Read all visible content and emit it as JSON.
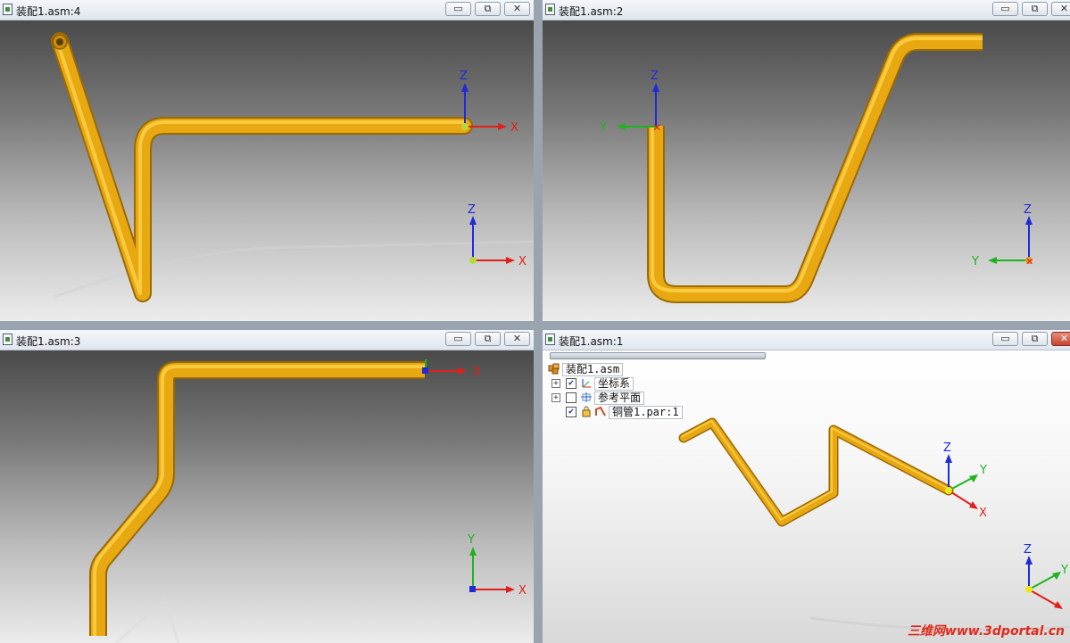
{
  "colors": {
    "pipe": "#e7a812",
    "pipe_highlight": "#ffd24a",
    "axis_x": "#e0201a",
    "axis_y": "#1fb31f",
    "axis_z": "#1e2cd8",
    "watermark": "#e0291b"
  },
  "axis_labels": {
    "x": "X",
    "y": "Y",
    "z": "Z"
  },
  "panes": [
    {
      "title": "装配1.asm:4",
      "buttons": {
        "minimize": "▭",
        "restore": "⧉",
        "close": "✕"
      }
    },
    {
      "title": "装配1.asm:2",
      "buttons": {
        "minimize": "▭",
        "restore": "⧉",
        "close": "✕"
      }
    },
    {
      "title": "装配1.asm:3",
      "buttons": {
        "minimize": "▭",
        "restore": "⧉",
        "close": "✕"
      }
    },
    {
      "title": "装配1.asm:1",
      "buttons": {
        "minimize": "▭",
        "restore": "⧉",
        "close": "✕"
      }
    }
  ],
  "tree": {
    "root": "装配1.asm",
    "items": [
      {
        "label": "坐标系",
        "expander": "+",
        "checked": "✔"
      },
      {
        "label": "参考平面",
        "expander": "+",
        "checked": ""
      },
      {
        "label": "铜管1.par:1",
        "expander": "",
        "checked": "✔"
      }
    ]
  },
  "watermark": "三维网www.3dportal.cn"
}
